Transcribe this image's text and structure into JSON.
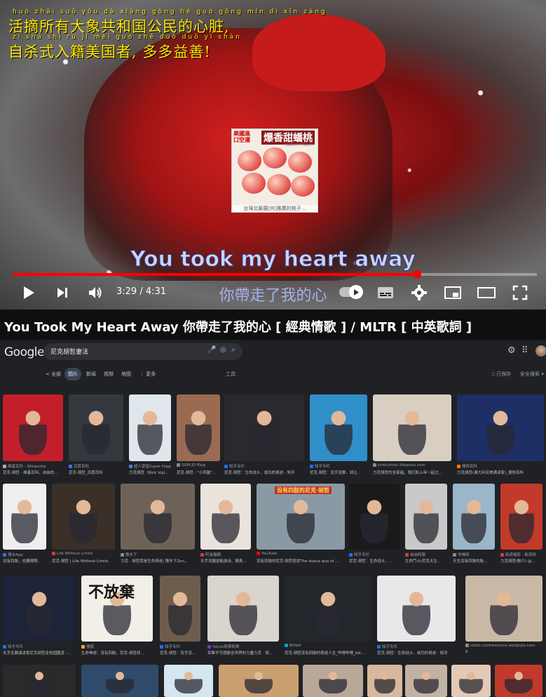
{
  "player": {
    "overlay_pinyin_1": "huó zhāi suǒ yǒu dà xiàng gòng hé guó gōng mín di xīn zàng",
    "overlay_line_1": "活摘所有大象共和国公民的心脏,",
    "overlay_pinyin_2": "zì shā shì rù jí měi guó zhě duō duō yì shàn",
    "overlay_line_2": "自杀式入籍美国者, 多多益善!",
    "ad": {
      "tag": "美國進口空運",
      "title": "爆香甜蟠桃",
      "subtitle": "Saturn Peach",
      "caption": "台灣北藝園[何]推薦的桃子..."
    },
    "lyric_en": "You took my heart away",
    "lyric_zh": "你帶走了我的心",
    "time_current": "3:29",
    "time_total": "4:31",
    "time_separator": " / ",
    "progress_fraction": 0.771,
    "accent_color": "#ff0000",
    "controls": [
      "play-icon",
      "next-icon",
      "volume-icon",
      "autoplay-toggle",
      "subtitles-icon",
      "settings-icon",
      "miniplayer-icon",
      "theater-icon",
      "fullscreen-icon"
    ]
  },
  "video_title": "You Took My Heart Away 你帶走了我的心 [ 經典情歌 ] / MLTR [ 中英歌詞 ]",
  "search": {
    "logo": "Google",
    "query": "尼克胡哲妻法",
    "tabs": [
      "< 全部",
      "图片",
      "新闻",
      "视频",
      "地图",
      "⋮ 更多"
    ],
    "active_tab": "图片",
    "tools": "工具",
    "saved": "已保存",
    "safe_search": "安全搜索 ▾",
    "rows": [
      [
        {
          "source": "维基百科 - Wikipedia",
          "caption": "尼克·胡哲 - 维基百科，自由的...",
          "color": "#c21f2a",
          "fav": "#aaaaaa"
        },
        {
          "source": "百度百科",
          "caption": "尼克·胡哲_百度百科",
          "color": "#33383f",
          "fav": "#3875f6"
        },
        {
          "source": "超人學堂Super Happ...",
          "caption": "力克胡哲（Nick Vuji...",
          "color": "#dfe7ec",
          "fav": "#4a7bd0"
        },
        {
          "source": "SGM.JD Blog",
          "caption": "尼克·胡哲 - \"小鸡腿\"...",
          "color": "#9a6a52",
          "fav": "#888888"
        },
        {
          "source": "知乎专栏",
          "caption": "尼克·胡哲：生命战士，成功的奇迹 - 知乎",
          "color": "#2a2a2e",
          "fav": "#1772f6"
        },
        {
          "source": "知乎专栏",
          "caption": "尼克·胡哲：没手没脚，却让...",
          "color": "#2f8fc9",
          "fav": "#1772f6"
        },
        {
          "source": "production.lifejezou.com",
          "caption": "力克胡哲的全家福，我们和上帝一起过...",
          "color": "#d8cfc2",
          "fav": "#888888"
        },
        {
          "source": "搜狗百科",
          "caption": "力克胡哲(澳大利亚美满讲家)_搜狗百科",
          "color": "#1e2f66",
          "fav": "#ff7a00"
        }
      ],
      [
        {
          "source": "搜冰App",
          "caption": "没有四肢，也要翱翔...",
          "color": "#eeeeee",
          "fav": "#3a6fd8"
        },
        {
          "source": "Life Without Limits",
          "caption": "尼克·胡哲 | Life Without Limits",
          "color": "#3a3028",
          "fav": "#d23b3b"
        },
        {
          "source": "豫东下",
          "caption": "力克 · 胡哲竟是生命奇迹| 豫东下Zen...",
          "color": "#6e6258",
          "fav": "#888888"
        },
        {
          "source": "阿波羅網",
          "caption": "无手没腿卻能游泳、騎馬...",
          "color": "#e9e3dc",
          "fav": "#d23b3b"
        },
        {
          "source": "YouTube",
          "caption": "没有四肢的尼克·胡哲现状The status quo of ...",
          "color": "#8a9aa5",
          "fav": "#ff0000"
        },
        {
          "source": "知乎专栏",
          "caption": "尼克·胡哲：生命战士，...",
          "color": "#1a1a1a",
          "fav": "#1772f6"
        },
        {
          "source": "自由時報",
          "caption": "生命鬥士/尼克天生...",
          "color": "#c9c9c9",
          "fav": "#d23b3b"
        },
        {
          "source": "学佛网",
          "caption": "天生没有四肢的胎...",
          "color": "#9ab6c8",
          "fav": "#888888"
        },
        {
          "source": "新浪電影 · 新浪网",
          "caption": "力克胡哲(駭介) @...",
          "color": "#c23a2a",
          "fav": "#d23b3b"
        }
      ],
      [
        {
          "source": "知乎专栏",
          "caption": "无手无脚演讲家尼克胡哲走校园圍凌 -...",
          "color": "#1d2338",
          "fav": "#1772f6"
        },
        {
          "source": "搜狐",
          "caption": "生命神迹：没有四肢，尼克·胡哲却...",
          "color": "#f2eee8",
          "fav": "#f5a623"
        },
        {
          "source": "知乎专栏",
          "caption": "尼克·胡哲：没手没...",
          "color": "#6f5d4c",
          "fav": "#1772f6"
        },
        {
          "source": "Yahoo奇摩新聞",
          "caption": "幸擊不可感動全世界的力量力克 · 胡...",
          "color": "#d9d4cc",
          "fav": "#7b2fd8"
        },
        {
          "source": "Bilibili",
          "caption": "尼克·胡哲没有四肢的奇迹人生_哔哩哔哩_bili...",
          "color": "#23262b",
          "fav": "#00a1d6"
        },
        {
          "source": "知乎专栏",
          "caption": "尼克·胡哲：生命战士，成功的奇迹 - 知乎",
          "color": "#e8e8e8",
          "fav": "#1772f6"
        },
        {
          "source": "static.contresource.weiqiujia.com",
          "caption": "0",
          "color": "#c9b8a6",
          "fav": "#888888"
        }
      ],
      [
        {
          "color": "#2a2a2a"
        },
        {
          "color": "#2f4a6a"
        },
        {
          "color": "#d4e6f2"
        },
        {
          "color": "#caa071"
        },
        {
          "color": "#b9a898"
        },
        {
          "color": "#d7b89c"
        },
        {
          "color": "#c2b2a2"
        },
        {
          "color": "#e3c9b6"
        },
        {
          "color": "#c0392b"
        }
      ]
    ],
    "row3_overlay": "不放棄",
    "row2_overlay": "没有四肢的尼克·胡哲"
  }
}
